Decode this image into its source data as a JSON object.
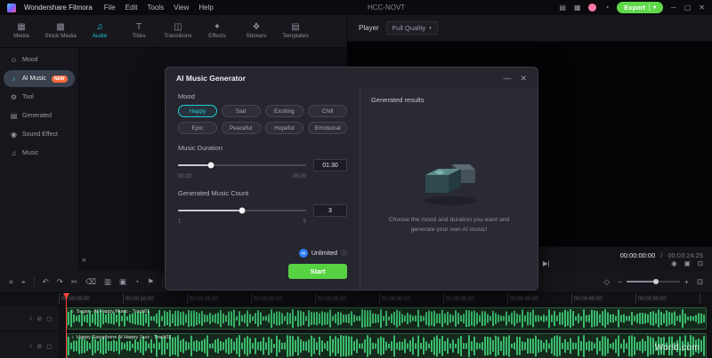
{
  "titlebar": {
    "app_name": "Wondershare Filmora",
    "menus": [
      "File",
      "Edit",
      "Tools",
      "View",
      "Help"
    ],
    "project_name": "HCC-NOVT",
    "export_label": "Export",
    "icons": [
      {
        "name": "layout-icon",
        "glyph": "▤"
      },
      {
        "name": "plugins-icon",
        "glyph": "▦"
      },
      {
        "name": "notification-icon",
        "glyph": "◔"
      },
      {
        "name": "chevron-down-icon",
        "glyph": "▾"
      },
      {
        "name": "minimize-icon",
        "glyph": "─"
      },
      {
        "name": "maximize-icon",
        "glyph": "▢"
      },
      {
        "name": "close-icon",
        "glyph": "✕"
      }
    ]
  },
  "ribbon": {
    "tabs": [
      {
        "label": "Media",
        "glyph": "▦"
      },
      {
        "label": "Stock Media",
        "glyph": "▩"
      },
      {
        "label": "Audio",
        "glyph": "♫",
        "active": true
      },
      {
        "label": "Titles",
        "glyph": "T"
      },
      {
        "label": "Transitions",
        "glyph": "◫"
      },
      {
        "label": "Effects",
        "glyph": "✦"
      },
      {
        "label": "Stickers",
        "glyph": "❖"
      },
      {
        "label": "Templates",
        "glyph": "▤"
      }
    ]
  },
  "sidebar": {
    "items": [
      {
        "label": "Mood",
        "glyph": "☺"
      },
      {
        "label": "AI Music",
        "glyph": "♪",
        "badge": "NEW",
        "active": true
      },
      {
        "label": "Tool",
        "glyph": "⚙"
      },
      {
        "label": "Generated",
        "glyph": "▤"
      },
      {
        "label": "Sound Effect",
        "glyph": "◉"
      },
      {
        "label": "Music",
        "glyph": "♫"
      }
    ],
    "collapse_glyph": "«"
  },
  "player": {
    "label": "Player",
    "quality": "Full Quality",
    "quality_caret": "▾",
    "mark_in_out": "{ }",
    "timecode_current": "00:00:00:00",
    "timecode_separator": "/",
    "timecode_total": "00:03:24:25",
    "transport": [
      {
        "name": "previous-frame-icon",
        "glyph": "|◀"
      },
      {
        "name": "play-icon",
        "glyph": "▶"
      },
      {
        "name": "next-frame-icon",
        "glyph": "▶|"
      }
    ],
    "tools": [
      {
        "name": "snapshot-icon",
        "glyph": "◉"
      },
      {
        "name": "crop-icon",
        "glyph": "▣"
      },
      {
        "name": "fullscreen-icon",
        "glyph": "⊡"
      }
    ]
  },
  "dialog": {
    "title": "AI Music Generator",
    "minimize_glyph": "—",
    "close_glyph": "✕",
    "mood_label": "Mood",
    "moods": [
      "Happy",
      "Sad",
      "Exciting",
      "Chill",
      "Epic",
      "Peaceful",
      "Hopeful",
      "Emotional"
    ],
    "selected_mood": "Happy",
    "duration_label": "Music Duration",
    "duration_value": "01:30",
    "duration_min": "00:20",
    "duration_max": "05:00",
    "duration_percent": 26,
    "count_label": "Generated Music Count",
    "count_value": "3",
    "count_min": "1",
    "count_max": "5",
    "count_percent": 50,
    "unlimited_label": "Unlimited",
    "unlimited_glyph": "∞",
    "info_glyph": "ⓘ",
    "start_label": "Start",
    "results_title": "Generated results",
    "results_hint": "Choose the mood and duration you want and generate your own AI music!"
  },
  "timeline": {
    "tools_left": [
      {
        "name": "snap-icon",
        "glyph": "⌗"
      },
      {
        "name": "pointer-tool-icon",
        "glyph": "⌖"
      },
      {
        "name": "undo-icon",
        "glyph": "↶"
      },
      {
        "name": "redo-icon",
        "glyph": "↷"
      },
      {
        "name": "scissors-icon",
        "glyph": "✂"
      },
      {
        "name": "trash-icon",
        "glyph": "⌫"
      },
      {
        "name": "split-icon",
        "glyph": "▥"
      },
      {
        "name": "crop-icon",
        "glyph": "▣"
      },
      {
        "name": "speed-icon",
        "glyph": "◔"
      },
      {
        "name": "marker-icon",
        "glyph": "⚑"
      }
    ],
    "tools_mid": [
      {
        "name": "voiceover-icon",
        "glyph": "◉"
      },
      {
        "name": "mixer-icon",
        "glyph": "▥"
      },
      {
        "name": "render-preview-icon",
        "glyph": "▸"
      }
    ],
    "tools_right": [
      {
        "name": "keyframe-icon",
        "glyph": "◇"
      },
      {
        "name": "zoom-out-icon",
        "glyph": "−"
      },
      {
        "name": "zoom-in-icon",
        "glyph": "+"
      },
      {
        "name": "fit-timeline-icon",
        "glyph": "⊡"
      }
    ],
    "zoom_percent": 55,
    "ruler": [
      "00:00:05:00",
      "00:00:10:00",
      "00:00:15:00",
      "00:00:20:00",
      "00:00:25:00",
      "00:00:30:00",
      "00:00:35:00",
      "00:00:40:00",
      "00:00:45:00",
      "00:00:50:00"
    ],
    "track_icons": [
      {
        "name": "mute-icon",
        "glyph": "♪"
      },
      {
        "name": "lock-icon",
        "glyph": "⊘"
      },
      {
        "name": "hide-icon",
        "glyph": "◻"
      }
    ],
    "clips": [
      {
        "name": "Sugar - AI Happy Music - Track01",
        "glyph": "♪"
      },
      {
        "name": "Happy Saxophone AI Happy Jazz - Track02",
        "glyph": "♪"
      }
    ]
  },
  "watermark": "World.com",
  "colors": {
    "accent": "#1fc9d2",
    "export_green": "#5fd84a",
    "start_green": "#57d243",
    "badge_orange": "#ff6a3d",
    "waveform_green": "#3ecb76",
    "playhead_red": "#ff4538"
  }
}
